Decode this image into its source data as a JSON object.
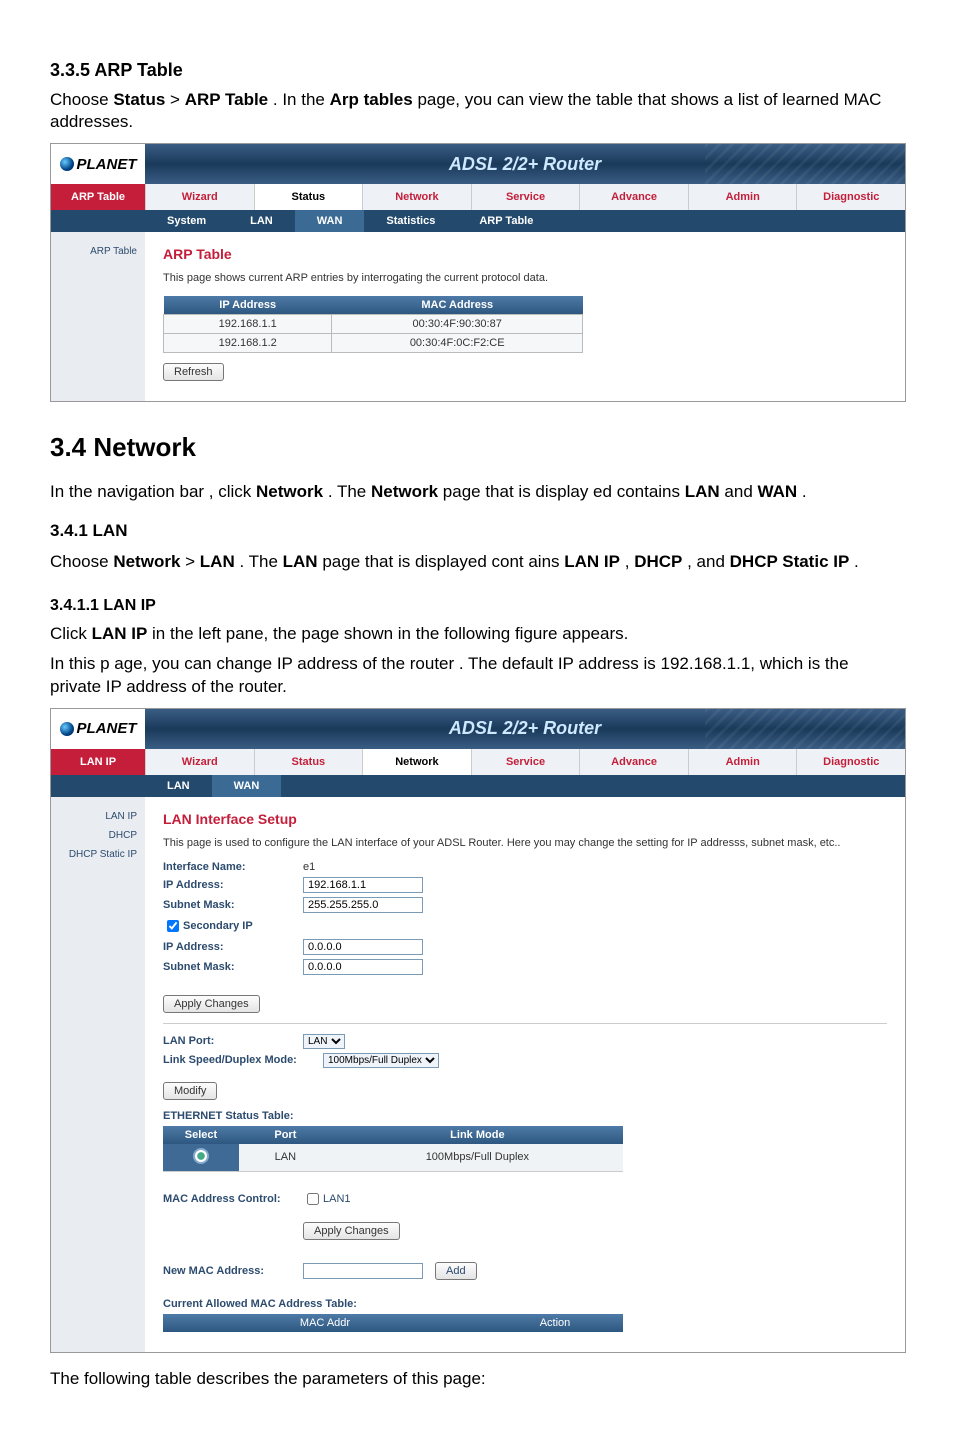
{
  "doc": {
    "s335": "3.3.5 ARP Table",
    "p335a": "Choose ",
    "p335b": "Status",
    "p335c": " > ",
    "p335d": "ARP Table",
    "p335e": ". In the ",
    "p335f": "Arp tables",
    "p335g": " page, you can view the table that shows a list of learned MAC addresses.",
    "s34": "3.4 Network",
    "p34a": "In the navigation bar , click ",
    "p34b": "Network",
    "p34c": ". The ",
    "p34d": "Network",
    "p34e": " page that is display ed contains ",
    "p34f": "LAN",
    "p34g": " and ",
    "p34h": "WAN",
    "p34i": ".",
    "s341": "3.4.1 LAN",
    "p341a": "Choose ",
    "p341b": "Network",
    "p341c": " > ",
    "p341d": "LAN",
    "p341e": ". The ",
    "p341f": "LAN",
    "p341g": " page that is displayed cont ains ",
    "p341h": "LAN IP",
    "p341i": ", ",
    "p341j": "DHCP",
    "p341k": ", and ",
    "p341l": "DHCP Static IP",
    "p341m": ".",
    "s3411": "3.4.1.1 LAN IP",
    "p3411a": "Click ",
    "p3411b": "LAN IP",
    "p3411c": " in the left pane, the page shown in the following figure appears.",
    "p3411d": "In this p  age, you can change IP    address of   the router . The default IP   address is 192.168.1.1, which is the private IP address of the router.",
    "footer": "The following table describes the parameters of this page:"
  },
  "router": {
    "brand": "PLANET",
    "product_title": "ADSL 2/2+ Router",
    "tabs": [
      "Wizard",
      "Status",
      "Network",
      "Service",
      "Advance",
      "Admin",
      "Diagnostic"
    ]
  },
  "arp_panel": {
    "active_tab": "Status",
    "nav_title": "ARP Table",
    "subnav": [
      "System",
      "LAN",
      "WAN",
      "Statistics",
      "ARP Table"
    ],
    "subnav_active": "ARP Table",
    "left_items": [
      "ARP Table"
    ],
    "title": "ARP Table",
    "desc": "This page shows current ARP entries by interrogating the current protocol data.",
    "cols": [
      "IP Address",
      "MAC Address"
    ],
    "rows": [
      [
        "192.168.1.1",
        "00:30:4F:90:30:87"
      ],
      [
        "192.168.1.2",
        "00:30:4F:0C:F2:CE"
      ]
    ],
    "refresh": "Refresh"
  },
  "lan_panel": {
    "active_tab": "Network",
    "nav_title": "LAN IP",
    "subnav": [
      "LAN",
      "WAN"
    ],
    "subnav_active": "LAN",
    "left_items": [
      "LAN IP",
      "DHCP",
      "DHCP Static IP"
    ],
    "title": "LAN Interface Setup",
    "desc": "This page is used to configure the LAN interface of your ADSL Router. Here you may change the setting for IP addresss, subnet mask, etc..",
    "fields": {
      "ifname_lbl": "Interface Name:",
      "ifname_val": "e1",
      "ip_lbl": "IP Address:",
      "ip_val": "192.168.1.1",
      "mask_lbl": "Subnet Mask:",
      "mask_val": "255.255.255.0",
      "secondary_lbl": "Secondary IP",
      "ip2_lbl": "IP Address:",
      "ip2_val": "0.0.0.0",
      "mask2_lbl": "Subnet Mask:",
      "mask2_val": "0.0.0.0",
      "apply": "Apply Changes",
      "lanport_lbl": "LAN Port:",
      "lanport_val": "LAN",
      "link_lbl": "Link Speed/Duplex Mode:",
      "link_val": "100Mbps/Full Duplex",
      "modify": "Modify",
      "eth_title": "ETHERNET Status Table:",
      "eth_cols": [
        "Select",
        "Port",
        "Link Mode"
      ],
      "eth_row_port": "LAN",
      "eth_row_mode": "100Mbps/Full Duplex",
      "macctrl_lbl": "MAC Address Control:",
      "macctrl_chk": "LAN1",
      "apply2": "Apply Changes",
      "newmac_lbl": "New MAC Address:",
      "add": "Add",
      "macaddr_title": "Current Allowed MAC Address Table:",
      "mac_cols": [
        "MAC Addr",
        "Action"
      ]
    }
  }
}
